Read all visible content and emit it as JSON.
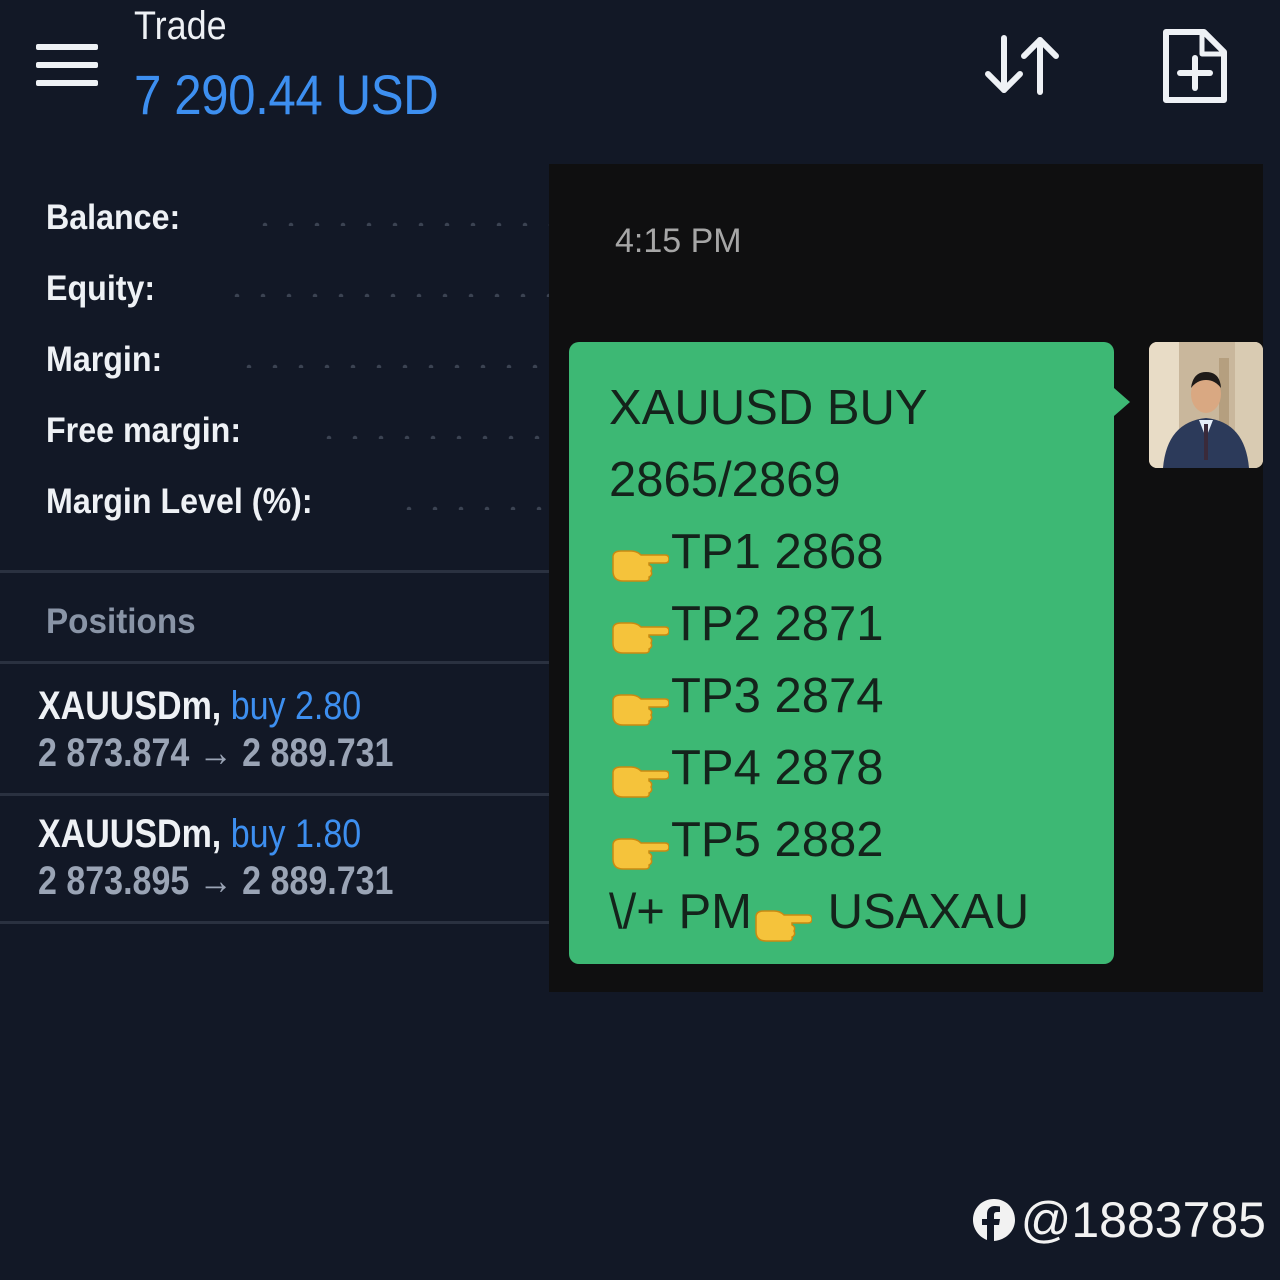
{
  "header": {
    "title": "Trade",
    "balance": "7 290.44 USD",
    "icons": {
      "menu": "hamburger-menu-icon",
      "sort": "sort-arrows-icon",
      "new_order": "new-document-plus-icon"
    }
  },
  "summary": {
    "rows": [
      {
        "label": "Balance:"
      },
      {
        "label": "Equity:"
      },
      {
        "label": "Margin:"
      },
      {
        "label": "Free margin:"
      },
      {
        "label": "Margin Level (%):"
      }
    ]
  },
  "positions": {
    "header": "Positions",
    "items": [
      {
        "symbol": "XAUUSDm,",
        "direction_volume": "buy 2.80",
        "open": "2 873.874",
        "arrow": "→",
        "current": "2 889.731"
      },
      {
        "symbol": "XAUUSDm,",
        "direction_volume": "buy 1.80",
        "open": "2 873.895",
        "arrow": "→",
        "current": "2 889.731"
      }
    ]
  },
  "chat": {
    "time": "4:15 PM",
    "lines": [
      {
        "text": "XAUUSD BUY"
      },
      {
        "text": "2865/2869"
      },
      {
        "text": "TP1 2868",
        "icon": "pointing-hand-icon"
      },
      {
        "text": "TP2 2871",
        "icon": "pointing-hand-icon"
      },
      {
        "text": "TP3 2874",
        "icon": "pointing-hand-icon"
      },
      {
        "text": "TP4 2878",
        "icon": "pointing-hand-icon"
      },
      {
        "text": "TP5 2882",
        "icon": "pointing-hand-icon"
      }
    ],
    "last_line": {
      "prefix": "\\/+ PM",
      "suffix": " USAXAU"
    },
    "bubble_color": "#3db874"
  },
  "watermark": {
    "handle": "@1883785",
    "icon": "facebook-icon"
  },
  "colors": {
    "background": "#121826",
    "accent": "#3d8ff0"
  }
}
